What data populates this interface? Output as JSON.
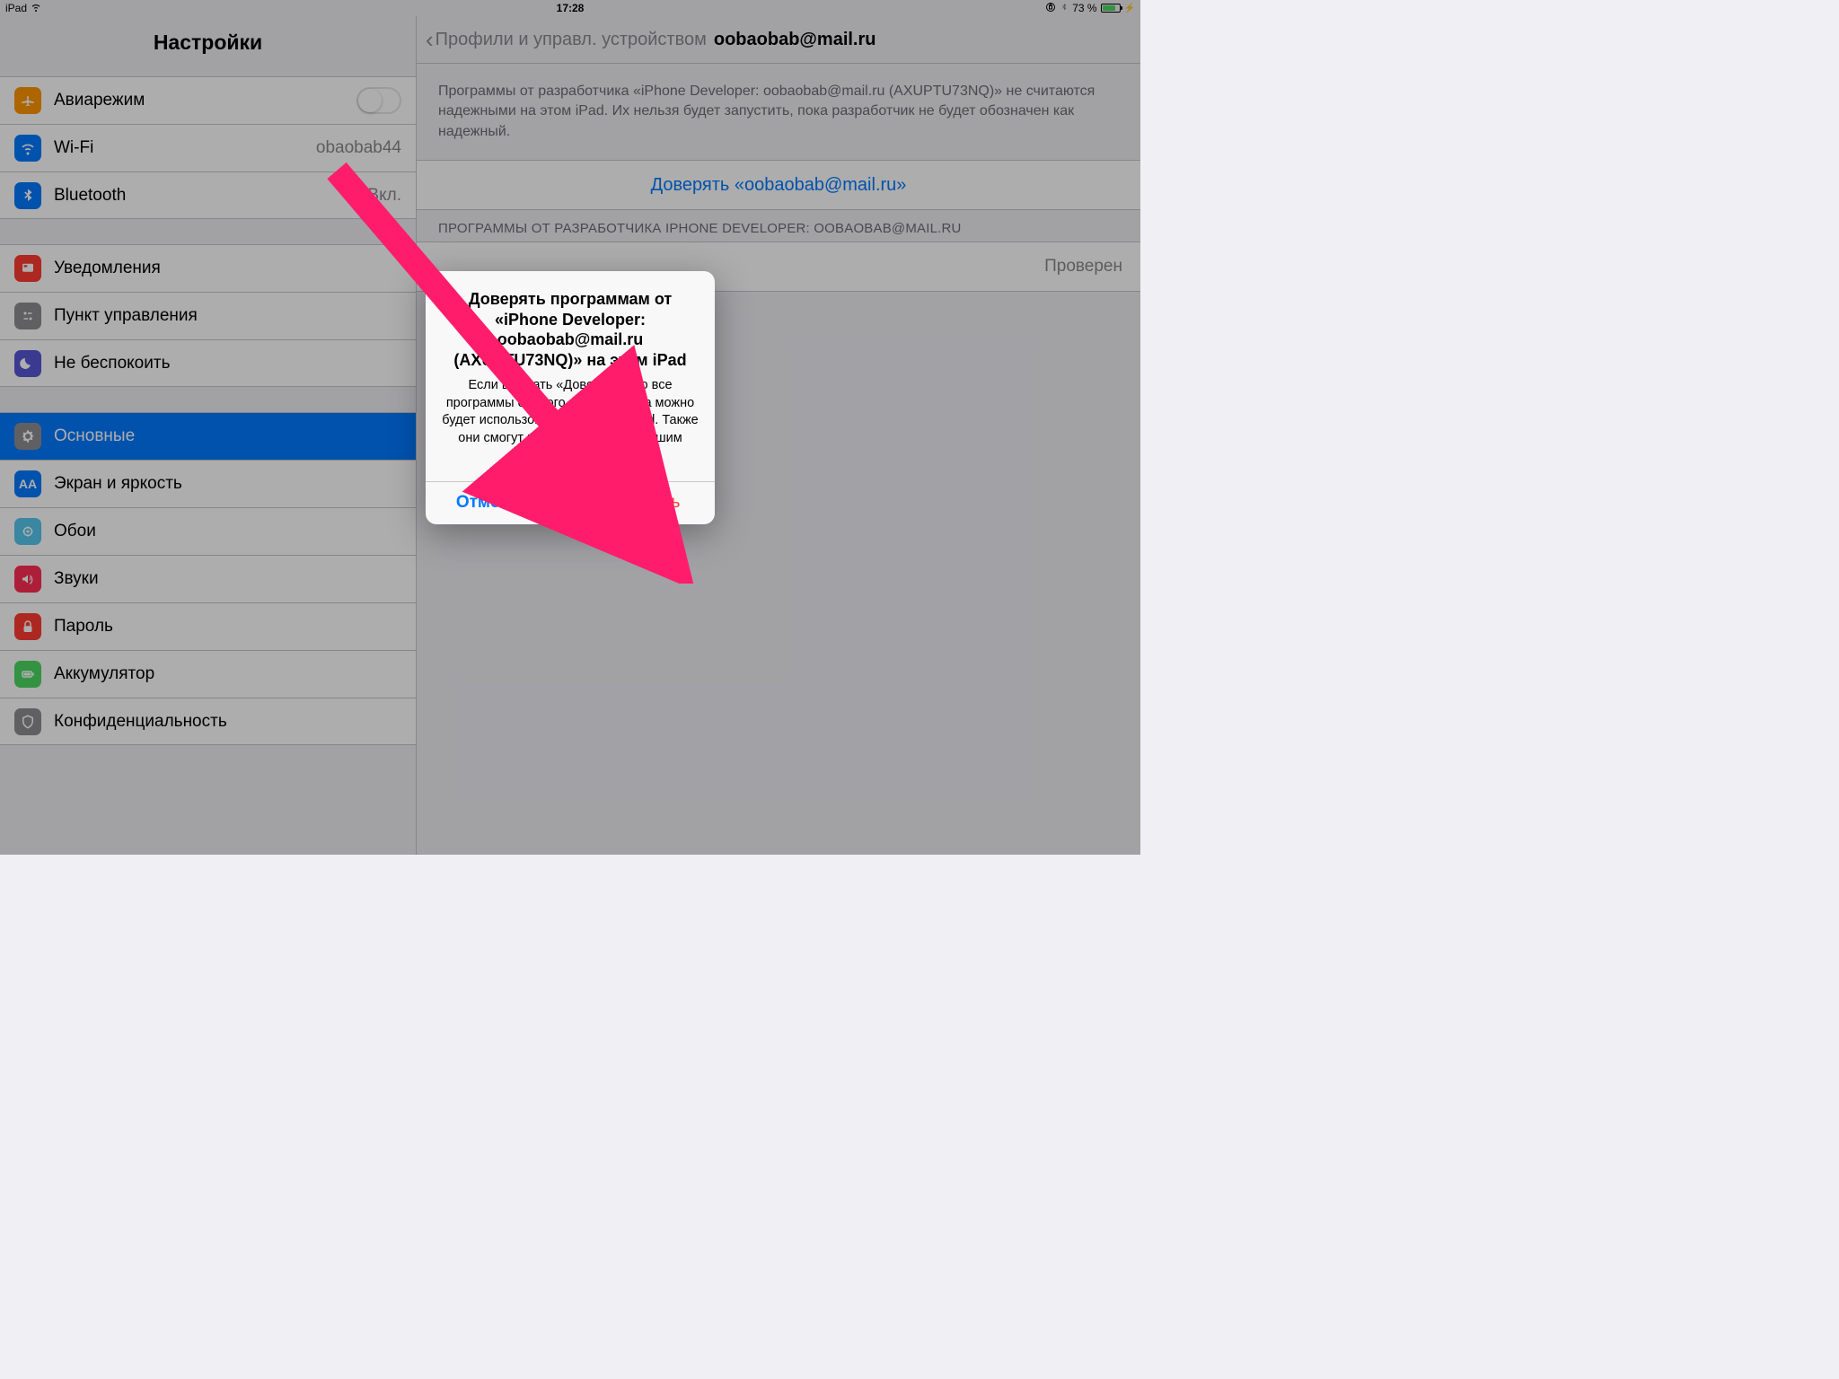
{
  "status": {
    "device": "iPad",
    "time": "17:28",
    "battery_pct": "73 %"
  },
  "sidebar": {
    "title": "Настройки",
    "rows": {
      "airplane": "Авиарежим",
      "wifi": "Wi-Fi",
      "wifi_value": "obaobab44",
      "bluetooth": "Bluetooth",
      "bluetooth_value": "Вкл.",
      "notifications": "Уведомления",
      "control_center": "Пункт управления",
      "dnd": "Не беспокоить",
      "general": "Основные",
      "display": "Экран и яркость",
      "wallpaper": "Обои",
      "sounds": "Звуки",
      "passcode": "Пароль",
      "battery": "Аккумулятор",
      "privacy": "Конфиденциальность"
    }
  },
  "detail": {
    "back_label": "Профили и управл. устройством",
    "title": "oobaobab@mail.ru",
    "note": "Программы от разработчика «iPhone Developer: oobaobab@mail.ru (AXUPTU73NQ)» не считаются надежными на этом iPad. Их нельзя будет запустить, пока разработчик не будет обозначен как надежный.",
    "trust_link": "Доверять «oobaobab@mail.ru»",
    "apps_header": "ПРОГРАММЫ ОТ РАЗРАБОТЧИКА IPHONE DEVELOPER: OOBAOBAB@MAIL.RU",
    "verified": "Проверен"
  },
  "alert": {
    "title": "Доверять программам от «iPhone Developer: oobaobab@mail.ru (AXUPTU73NQ)» на этом iPad",
    "message": "Если выбрать «Доверять», то все программы от этого разработчика можно будет использовать на Вашем iPad. Также они смогут получить доступ к Вашим данным.",
    "cancel": "Отменить",
    "trust": "Доверять"
  },
  "annotation": {
    "color": "#ff1d6b"
  }
}
